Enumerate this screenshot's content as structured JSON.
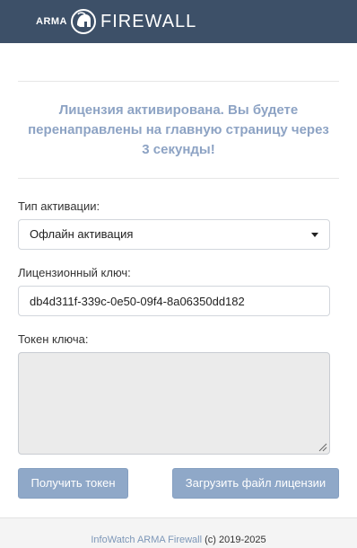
{
  "header": {
    "logo_brand": "ARMA",
    "logo_product": "FIREWALL",
    "logo_icon": "helmet-logo-icon",
    "background_color": "#3d5068"
  },
  "notice": {
    "message": "Лицензия активирована. Вы будете перенаправлены на главную страницу через 3 секунды!",
    "color": "#8da3c4"
  },
  "form": {
    "activation_type_label": "Тип активации:",
    "activation_type_value": "Офлайн активация",
    "license_key_label": "Лицензионный ключ:",
    "license_key_value": "db4d311f-339c-0e50-09f4-8a06350dd182",
    "key_token_label": "Токен ключа:",
    "key_token_value": ""
  },
  "buttons": {
    "get_token": "Получить токен",
    "upload_license": "Загрузить файл лицензии",
    "button_color": "#8fa8c8"
  },
  "footer": {
    "link_text": "InfoWatch ARMA Firewall",
    "copyright": "(c) 2019-2025"
  }
}
